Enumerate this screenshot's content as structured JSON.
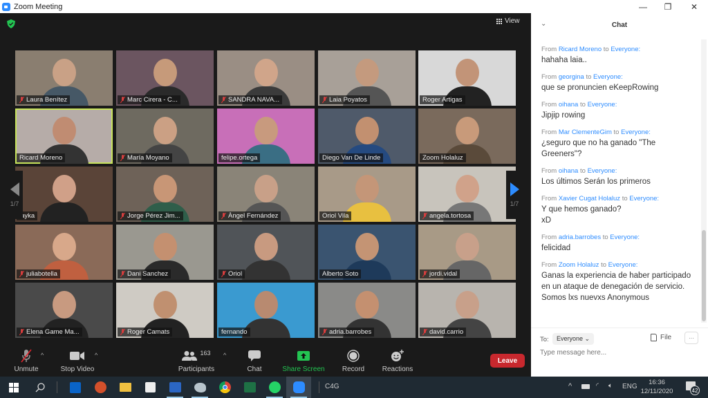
{
  "window": {
    "title": "Zoom Meeting",
    "controls": {
      "minimize": "—",
      "maximize": "❐",
      "close": "✕"
    }
  },
  "meeting": {
    "security_icon": "shield-check-icon",
    "view_label": "View",
    "page_indicator_left": "1/7",
    "page_indicator_right": "1/7",
    "active_speaker": "Ricard Moreno",
    "participants": [
      {
        "name": "Laura Benítez",
        "muted": true,
        "bg": "#8a7e70",
        "face": "#c9a186",
        "shirt": "#465866"
      },
      {
        "name": "Marc Cirera - C...",
        "muted": true,
        "bg": "#6b5560",
        "face": "#c69a7a",
        "shirt": "#2a2a2a"
      },
      {
        "name": "SANDRA NAVA...",
        "muted": true,
        "bg": "#9a8e84",
        "face": "#d0a58a",
        "shirt": "#3b3b3b"
      },
      {
        "name": "Laia Poyatos",
        "muted": true,
        "bg": "#a8a098",
        "face": "#c49a7e",
        "shirt": "#555"
      },
      {
        "name": "Roger Artigas",
        "muted": false,
        "bg": "#d8d8d8",
        "face": "#c29478",
        "shirt": "#222"
      },
      {
        "name": "Ricard Moreno",
        "muted": false,
        "bg": "#b6aca8",
        "face": "#c08c72",
        "shirt": "#333"
      },
      {
        "name": "María Moyano",
        "muted": true,
        "bg": "#6e6a60",
        "face": "#cba084",
        "shirt": "#444"
      },
      {
        "name": "felipe.ortega",
        "muted": false,
        "bg": "#c86fb8",
        "face": "#c89a7e",
        "shirt": "#3a6e84"
      },
      {
        "name": "Diego Van De Linde",
        "muted": false,
        "bg": "#4f5a6a",
        "face": "#c29070",
        "shirt": "#254a80"
      },
      {
        "name": "Zoom Holaluz",
        "muted": false,
        "bg": "#7a6a5c",
        "face": "#c89a7a",
        "shirt": "#5a4a3a"
      },
      {
        "name": "layka",
        "muted": false,
        "bg": "#5a4438",
        "face": "#d0a088",
        "shirt": "#222"
      },
      {
        "name": "Jorge Pérez Jim...",
        "muted": true,
        "bg": "#6e6258",
        "face": "#c89676",
        "shirt": "#2f5e4a"
      },
      {
        "name": "Àngel Fernández",
        "muted": true,
        "bg": "#8a8478",
        "face": "#c8a088",
        "shirt": "#555"
      },
      {
        "name": "Oriol Vila",
        "muted": false,
        "bg": "#a89a88",
        "face": "#c49678",
        "shirt": "#e8c040"
      },
      {
        "name": "angela.tortosa",
        "muted": true,
        "bg": "#c8c4bc",
        "face": "#d0a28a",
        "shirt": "#777"
      },
      {
        "name": "juliabotella",
        "muted": true,
        "bg": "#8a6a58",
        "face": "#d8a88a",
        "shirt": "#c06040"
      },
      {
        "name": "Dani Sanchez",
        "muted": true,
        "bg": "#9a9890",
        "face": "#c49070",
        "shirt": "#2a2a2a"
      },
      {
        "name": "Oriol",
        "muted": true,
        "bg": "#505458",
        "face": "#c89a80",
        "shirt": "#333"
      },
      {
        "name": "Alberto Soto",
        "muted": false,
        "bg": "#3a5470",
        "face": "#c49474",
        "shirt": "#1e3a5a"
      },
      {
        "name": "jordi.vidal",
        "muted": true,
        "bg": "#a89a86",
        "face": "#c8a08a",
        "shirt": "#666"
      },
      {
        "name": "Elena Game Ma...",
        "muted": true,
        "bg": "#4a4a4a",
        "face": "#c89a80",
        "shirt": "#222"
      },
      {
        "name": "Roger Camats",
        "muted": true,
        "bg": "#cfcbc4",
        "face": "#c09070",
        "shirt": "#222"
      },
      {
        "name": "fernando",
        "muted": false,
        "bg": "#3a9ad0",
        "face": "#b88a70",
        "shirt": "#333"
      },
      {
        "name": "adria.barrobes",
        "muted": true,
        "bg": "#8a8a88",
        "face": "#c49070",
        "shirt": "#333"
      },
      {
        "name": "david.carrio",
        "muted": true,
        "bg": "#b8b4ae",
        "face": "#c8a08a",
        "shirt": "#444"
      }
    ]
  },
  "toolbar": {
    "unmute": "Unmute",
    "stop_video": "Stop Video",
    "participants": "Participants",
    "participants_count": "163",
    "chat": "Chat",
    "share_screen": "Share Screen",
    "record": "Record",
    "reactions": "Reactions",
    "leave": "Leave",
    "caret": "^",
    "share_color": "#23c552",
    "leave_color": "#c8282e"
  },
  "chat": {
    "title": "Chat",
    "collapse_icon": "chevron-down-icon",
    "from_prefix": "From",
    "to_word": "to",
    "messages": [
      {
        "from": "Ricard Moreno",
        "to": "Everyone:",
        "text": "hahaha laia.."
      },
      {
        "from": "georgina",
        "to": "Everyone:",
        "text": "que se pronuncien eKeepRowing"
      },
      {
        "from": "oihana",
        "to": "Everyone:",
        "text": "Jipjip rowing"
      },
      {
        "from": "Mar ClementeGim",
        "to": "Everyone:",
        "text": "¿seguro que no ha ganado \"The Greeners\"?"
      },
      {
        "from": "oihana",
        "to": "Everyone:",
        "text": "Los últimos Serán los primeros"
      },
      {
        "from": "Xavier Cugat Holaluz",
        "to": "Everyone:",
        "text": "Y que hemos ganado?\nxD"
      },
      {
        "from": "adria.barrobes",
        "to": "Everyone:",
        "text": "felicidad"
      },
      {
        "from": "Zoom Holaluz",
        "to": "Everyone:",
        "text": "Ganas la experiencia de  haber participado en un ataque de denegación de servicio. Somos lxs nuevxs Anonymous"
      }
    ],
    "to_label": "To:",
    "recipient": "Everyone",
    "file_label": "File",
    "more_label": "···",
    "input_placeholder": "Type message here...",
    "accent": "#2d8cff"
  },
  "taskbar": {
    "apps": [
      "windows-start",
      "search",
      "outlook",
      "powerpoint",
      "file-explorer",
      "microsoft-store",
      "word",
      "paint",
      "chrome",
      "excel",
      "whatsapp",
      "zoom"
    ],
    "label": "C4G",
    "language": "ENG",
    "time": "16:36",
    "date": "12/11/2020",
    "notifications": "42"
  }
}
